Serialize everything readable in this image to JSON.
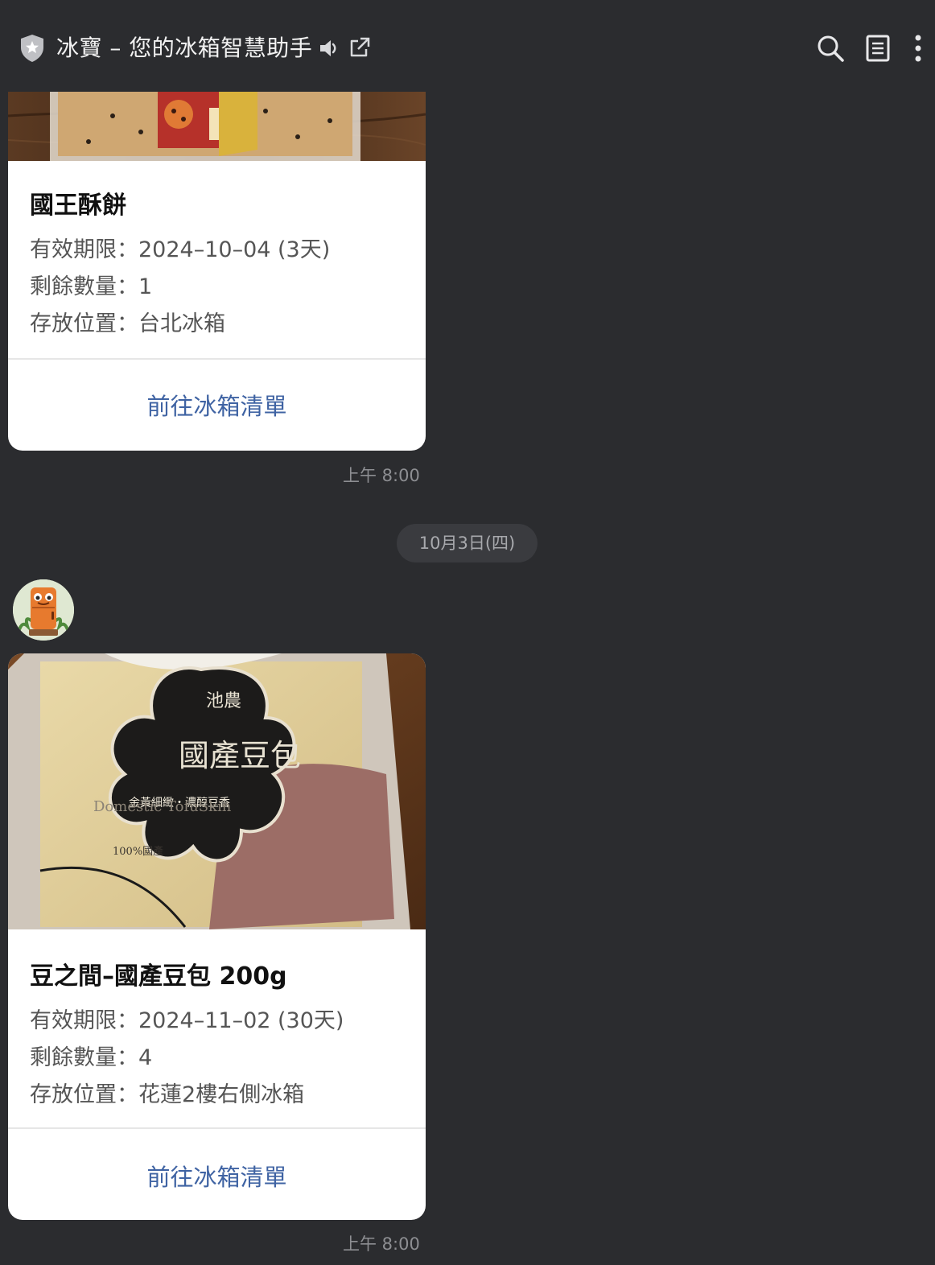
{
  "header": {
    "title": "冰寶 – 您的冰箱智慧助手",
    "icons": [
      "shield-icon",
      "speaker-icon",
      "popout-icon",
      "search-icon",
      "notes-icon",
      "more-icon"
    ]
  },
  "messages": [
    {
      "title": "國王酥餅",
      "expiry": "有效期限：2024–10–04 (3天)",
      "quantity": "剩餘數量：1",
      "location": "存放位置：台北冰箱",
      "action": "前往冰箱清單",
      "time": "上午 8:00"
    },
    {
      "title": "豆之間–國產豆包 200g",
      "expiry": "有效期限：2024–11–02 (30天)",
      "quantity": "剩餘數量：4",
      "location": "存放位置：花蓮2樓右側冰箱",
      "action": "前往冰箱清單",
      "time": "上午 8:00"
    }
  ],
  "date_separator": "10月3日(四)",
  "photo_text": {
    "brand": "池農",
    "product": "國產豆包",
    "tagline": "金黃細緻・濃醇豆香",
    "english": "Domestic TofuSkin",
    "note": "100%國產"
  },
  "colors": {
    "background": "#2b2c2f",
    "card": "#ffffff",
    "link": "#3f63a3",
    "date_pill": "#3a3b3f"
  }
}
